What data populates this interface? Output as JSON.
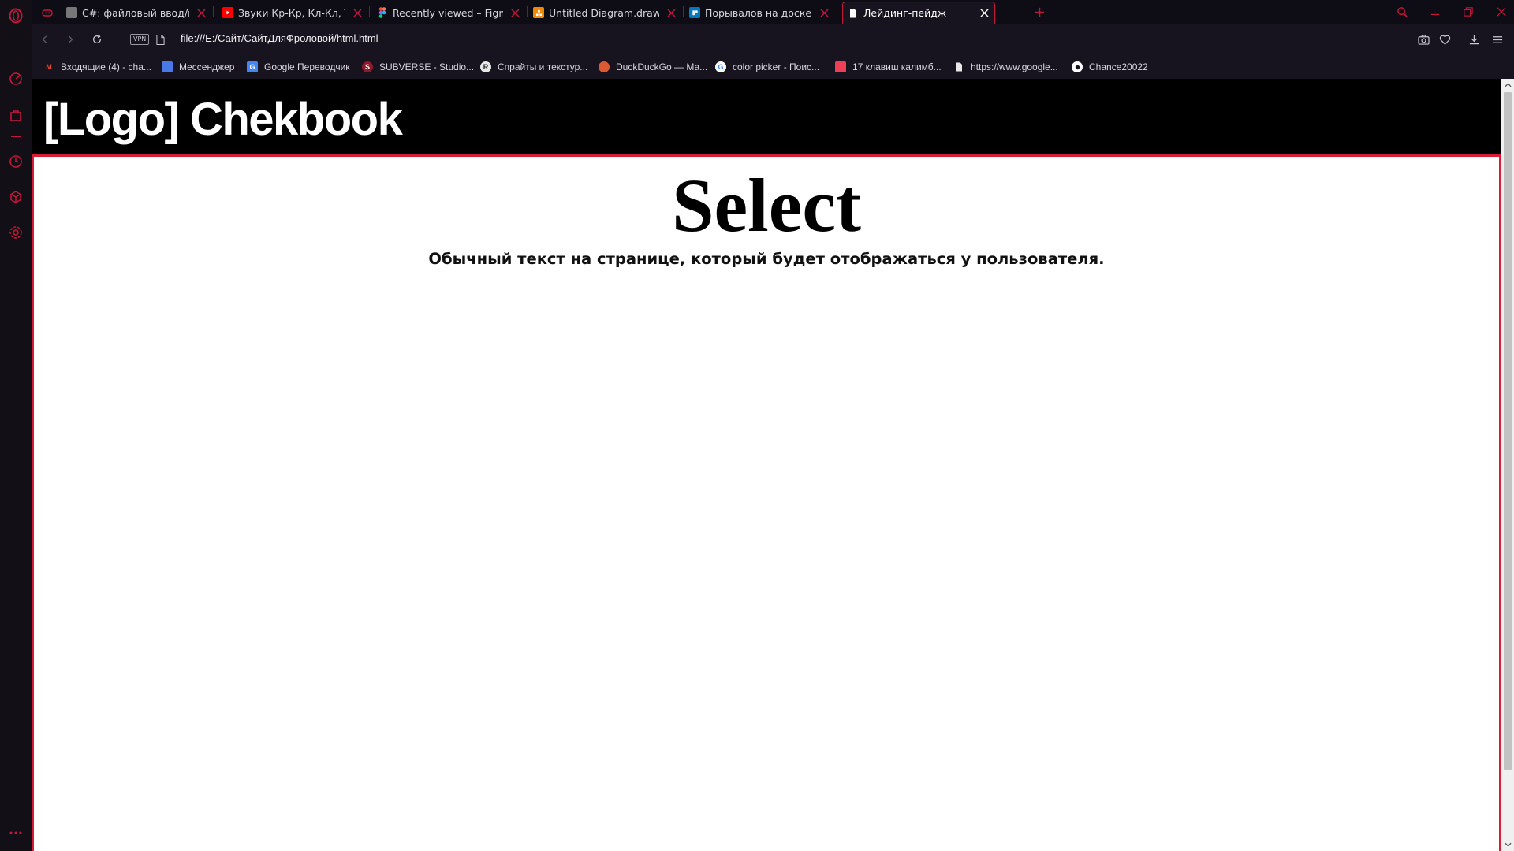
{
  "tabs": [
    {
      "title": "C#: файловый ввод/вывод",
      "favicon": "code-icon",
      "color": "#777777"
    },
    {
      "title": "Звуки Кр-Кр, Кл-Кл, Тк-Тк",
      "favicon": "youtube-icon",
      "color": "#ff0000"
    },
    {
      "title": "Recently viewed – Figma",
      "favicon": "figma-icon",
      "color": "#a259ff"
    },
    {
      "title": "Untitled Diagram.drawio - d",
      "favicon": "drawio-icon",
      "color": "#f08705"
    },
    {
      "title": "Порывалов на доске Проек",
      "favicon": "trello-icon",
      "color": "#0079bf"
    },
    {
      "title": "Лейдинг-пейдж",
      "favicon": "page-icon",
      "color": "#ffffff",
      "active": true
    }
  ],
  "address": {
    "vpn": "VPN",
    "url": "file:///E:/Сайт/СайтДляФроловой/html.html"
  },
  "bookmarks": [
    {
      "label": "Входящие (4) - cha...",
      "icon": "gmail-icon",
      "color": "#ea4335",
      "glyph": "M"
    },
    {
      "label": "Мессенджер",
      "icon": "messenger-icon",
      "color": "#4a78e6",
      "glyph": ""
    },
    {
      "label": "Google Переводчик",
      "icon": "google-translate-icon",
      "color": "#4285f4",
      "glyph": "G"
    },
    {
      "label": "SUBVERSE - Studio...",
      "icon": "subverse-icon",
      "color": "#8b1a2a",
      "glyph": "S"
    },
    {
      "label": "Спрайты и текстур...",
      "icon": "resource-icon",
      "color": "#e8e8e8",
      "glyph": "R"
    },
    {
      "label": "DuckDuckGo — Ма...",
      "icon": "duckduckgo-icon",
      "color": "#de5833",
      "glyph": ""
    },
    {
      "label": "color picker - Поис...",
      "icon": "google-icon",
      "color": "#ffffff",
      "glyph": "G"
    },
    {
      "label": "17 клавиш калимб...",
      "icon": "pocket-icon",
      "color": "#ef3f56",
      "glyph": ""
    },
    {
      "label": "https://www.google...",
      "icon": "page-icon",
      "color": "#e8e8e8",
      "glyph": ""
    },
    {
      "label": "Chance20022",
      "icon": "github-icon",
      "color": "#ffffff",
      "glyph": ""
    }
  ],
  "site": {
    "logo": "[Logo] Chekbook",
    "heading": "Select",
    "text": "Обычный текст на странице, который будет отображаться у пользователя."
  },
  "colors": {
    "accent": "#c4183a",
    "page_border": "#d81e36",
    "header_bg": "#000000",
    "chrome_bg": "#17141f"
  }
}
